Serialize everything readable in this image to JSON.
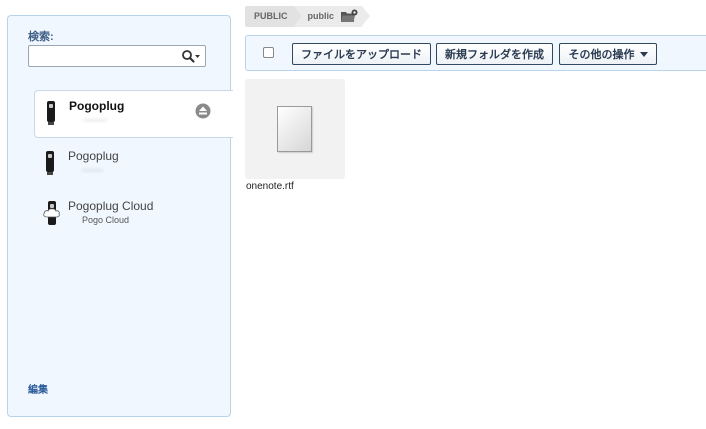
{
  "sidebar": {
    "search_label": "検索:",
    "search_value": "",
    "search_placeholder": "",
    "devices": [
      {
        "name": "Pogoplug",
        "sub": "--------",
        "selected": true
      },
      {
        "name": "Pogoplug",
        "sub": "-------"
      },
      {
        "name": "Pogoplug Cloud",
        "sub": "Pogo Cloud"
      }
    ],
    "edit_label": "編集"
  },
  "breadcrumb": {
    "root": "PUBLIC",
    "current": "public"
  },
  "toolbar": {
    "upload_label": "ファイルをアップロード",
    "new_folder_label": "新規フォルダを作成",
    "more_label": "その他の操作"
  },
  "files": [
    {
      "name": "onenote.rtf",
      "icon": "rtf-document-icon"
    }
  ],
  "colors": {
    "panel_bg": "#f0f7fe",
    "panel_border": "#b9d3ea",
    "button_border": "#33475e",
    "link": "#2d5c9a"
  }
}
